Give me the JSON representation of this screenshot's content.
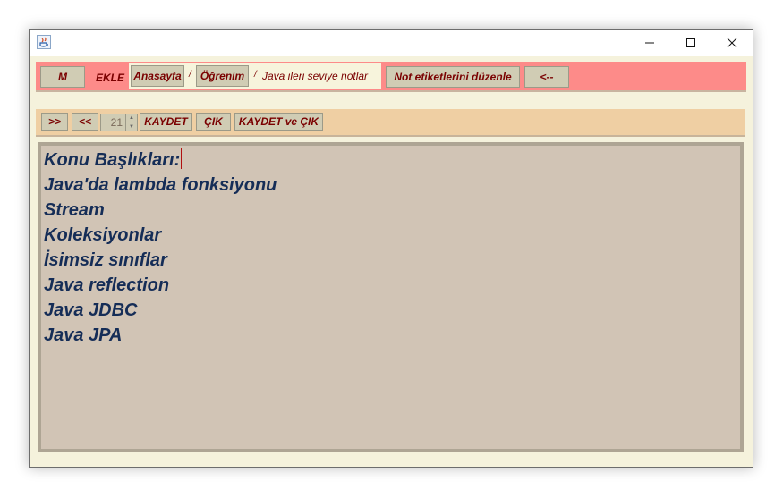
{
  "window": {
    "title": "",
    "controls": {
      "minimize_icon": "minimize-icon",
      "maximize_icon": "maximize-icon",
      "close_icon": "close-icon"
    }
  },
  "top_toolbar": {
    "m_label": "M",
    "ekle_label": "EKLE",
    "breadcrumb": {
      "items": [
        "Anasayfa",
        "Öğrenim"
      ],
      "separator": "/",
      "current": "Java ileri seviye notlar"
    },
    "edit_tags_label": "Not etiketlerini düzenle",
    "back_label": "<--"
  },
  "note_toolbar": {
    "next_label": ">>",
    "prev_label": "<<",
    "font_size_value": "21",
    "save_label": "KAYDET",
    "exit_label": "ÇIK",
    "save_exit_label": "KAYDET ve ÇIK"
  },
  "editor": {
    "lines": [
      "Konu Başlıkları:",
      "Java'da lambda fonksiyonu",
      "Stream",
      "Koleksiyonlar",
      "İsimsiz sınıflar",
      "Java reflection",
      "Java JDBC",
      "Java JPA"
    ]
  },
  "colors": {
    "top_bar": "#fd8b89",
    "note_bar": "#efcfa3",
    "editor_bg": "#d1c4b5",
    "editor_text": "#152d57",
    "button_text": "#7a0000"
  }
}
